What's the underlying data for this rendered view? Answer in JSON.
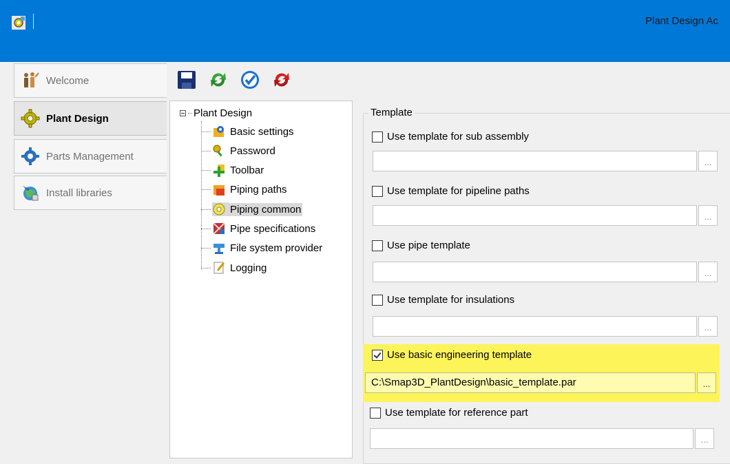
{
  "window": {
    "title": "Plant Design Ac"
  },
  "nav": {
    "items": [
      {
        "label": "Welcome",
        "icon": "welcome-people-icon",
        "active": false
      },
      {
        "label": "Plant Design",
        "icon": "plant-design-gear-icon",
        "active": true
      },
      {
        "label": "Parts Management",
        "icon": "parts-gear-icon",
        "active": false
      },
      {
        "label": "Install libraries",
        "icon": "install-globe-icon",
        "active": false
      }
    ]
  },
  "toolbar": {
    "buttons": [
      {
        "name": "save-icon",
        "color": "#1a2f6e"
      },
      {
        "name": "refresh-green-icon",
        "color": "#3aa43a"
      },
      {
        "name": "apply-check-icon",
        "color": "#1e6fd0"
      },
      {
        "name": "reset-red-icon",
        "color": "#d42020"
      }
    ]
  },
  "tree": {
    "root": "Plant Design",
    "items": [
      {
        "label": "Basic settings",
        "icon": "basic-settings-icon"
      },
      {
        "label": "Password",
        "icon": "password-key-icon"
      },
      {
        "label": "Toolbar",
        "icon": "toolbar-icon"
      },
      {
        "label": "Piping paths",
        "icon": "piping-paths-icon"
      },
      {
        "label": "Piping common",
        "icon": "piping-common-icon",
        "selected": true
      },
      {
        "label": "Pipe specifications",
        "icon": "pipe-specifications-icon"
      },
      {
        "label": "File system provider",
        "icon": "file-system-icon"
      },
      {
        "label": "Logging",
        "icon": "logging-icon"
      }
    ]
  },
  "template": {
    "group_title": "Template",
    "options": [
      {
        "label": "Use template for sub assembly",
        "checked": false,
        "path": ""
      },
      {
        "label": "Use template for pipeline paths",
        "checked": false,
        "path": ""
      },
      {
        "label": "Use pipe template",
        "checked": false,
        "path": ""
      },
      {
        "label": "Use template for insulations",
        "checked": false,
        "path": ""
      },
      {
        "label": "Use basic engineering template",
        "checked": true,
        "path": "C:\\Smap3D_PlantDesign\\basic_template.par"
      },
      {
        "label": "Use template for reference part",
        "checked": false,
        "path": ""
      }
    ],
    "browse_label": "...",
    "highlight_color": "#fdf45a"
  }
}
